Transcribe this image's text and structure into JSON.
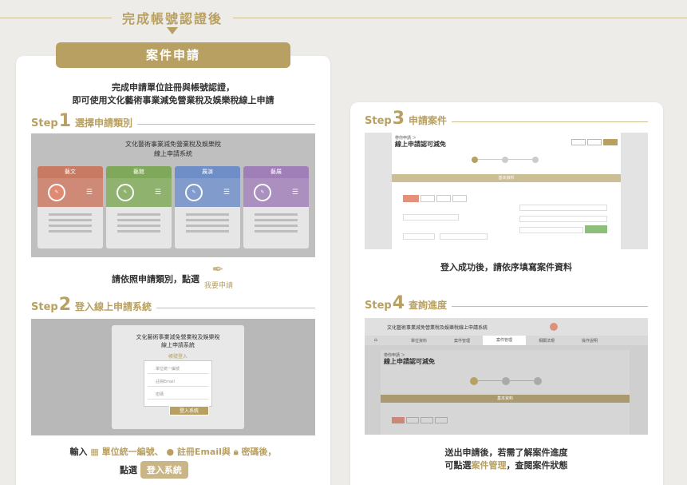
{
  "header": {
    "title": "完成帳號認證後"
  },
  "left_card": {
    "pill": "案件申請",
    "intro_line1": "完成申請單位註冊與帳號認證，",
    "intro_line2": "即可使用文化藝術事業減免營業稅及娛樂稅線上申請"
  },
  "steps": [
    {
      "label": "Step",
      "num": "1",
      "title": "選擇申請類別"
    },
    {
      "label": "Step",
      "num": "2",
      "title": "登入線上申請系統"
    },
    {
      "label": "Step",
      "num": "3",
      "title": "申請案件"
    },
    {
      "label": "Step",
      "num": "4",
      "title": "查詢進度"
    }
  ],
  "step1": {
    "screen_title1": "文化藝術事業減免營業稅及娛樂稅",
    "screen_title2": "線上申請系統",
    "categories": [
      {
        "name": "藝文",
        "color": "#c97a63"
      },
      {
        "name": "藝館",
        "color": "#7fa85a"
      },
      {
        "name": "展演",
        "color": "#6f8dc7"
      },
      {
        "name": "藝展",
        "color": "#a07fb8"
      }
    ],
    "apply_label": "我要申請",
    "caption": "請依照申請類別，點選",
    "caption_icon_text": "我要申請"
  },
  "step2": {
    "screen_title1": "文化藝術事業減免營業稅及娛樂稅",
    "screen_title2": "線上申請系統",
    "login_title": "帳號登入",
    "field1": "單位統一編號",
    "field2": "註冊Email",
    "field3": "密碼",
    "login_button": "登入系統",
    "cap_line1_a": "輸入",
    "cap_line1_b": "單位統一編號、",
    "cap_line1_c": "註冊Email與",
    "cap_line1_d": "密碼後，",
    "cap_line2": "點選",
    "cap_button": "登入系統"
  },
  "step3": {
    "breadcrumb": "帶你申請 ＞",
    "page_title": "線上申請認可減免",
    "section": "基本資料",
    "caption": "登入成功後，請依序填寫案件資料"
  },
  "step4": {
    "app_title": "文化藝術事業減免營業稅及娛樂稅線上申請系統",
    "nav": [
      "單位資料",
      "案件管理",
      "案件管理",
      "相關法規",
      "操作說明"
    ],
    "breadcrumb": "帶你申請 ＞",
    "page_title": "線上申請認可減免",
    "section": "基本資料",
    "caption_line1": "送出申請後，若需了解案件進度",
    "caption_line2_a": "可點選",
    "caption_line2_b": "案件管理",
    "caption_line2_c": "，查閱案件狀態"
  }
}
